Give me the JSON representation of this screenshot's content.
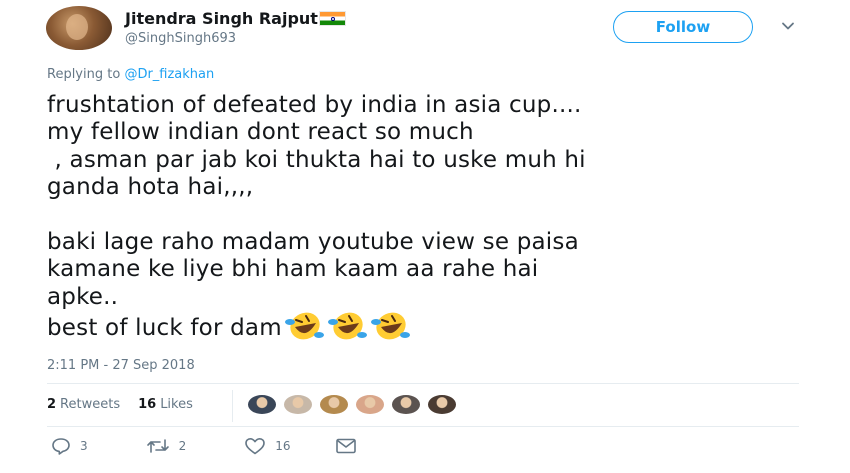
{
  "author": {
    "display_name": "Jitendra Singh Rajput",
    "handle": "@SinghSingh693",
    "flag_icon": "india-flag-icon"
  },
  "follow_label": "Follow",
  "reply_to": {
    "prefix": "Replying to ",
    "mention": "@Dr_fizakhan"
  },
  "tweet": {
    "lines": [
      "frushtation of defeated by india in asia cup....",
      "my fellow indian dont react so much",
      " , asman par jab koi thukta hai to uske muh hi",
      "ganda hota hai,,,,",
      "",
      "baki lage raho madam youtube view se paisa",
      "kamane ke liye bhi ham kaam aa rahe hai",
      "apke..",
      "best of luck for dam"
    ],
    "emoji": [
      "rolling-on-floor-laughing",
      "rolling-on-floor-laughing",
      "rolling-on-floor-laughing"
    ]
  },
  "timestamp": "2:11 PM - 27 Sep 2018",
  "stats": {
    "retweets_count": "2",
    "retweets_label": "Retweets",
    "likes_count": "16",
    "likes_label": "Likes"
  },
  "likers": [
    {
      "color": "#3a4658"
    },
    {
      "color": "#c7b8a8"
    },
    {
      "color": "#b48a4e"
    },
    {
      "color": "#d9a68a"
    },
    {
      "color": "#5b5350"
    },
    {
      "color": "#4a3b32"
    }
  ],
  "actions": {
    "reply_count": "3",
    "retweet_count": "2",
    "like_count": "16"
  },
  "colors": {
    "accent": "#1da1f2",
    "secondary_text": "#657786",
    "primary_text": "#14171a"
  }
}
